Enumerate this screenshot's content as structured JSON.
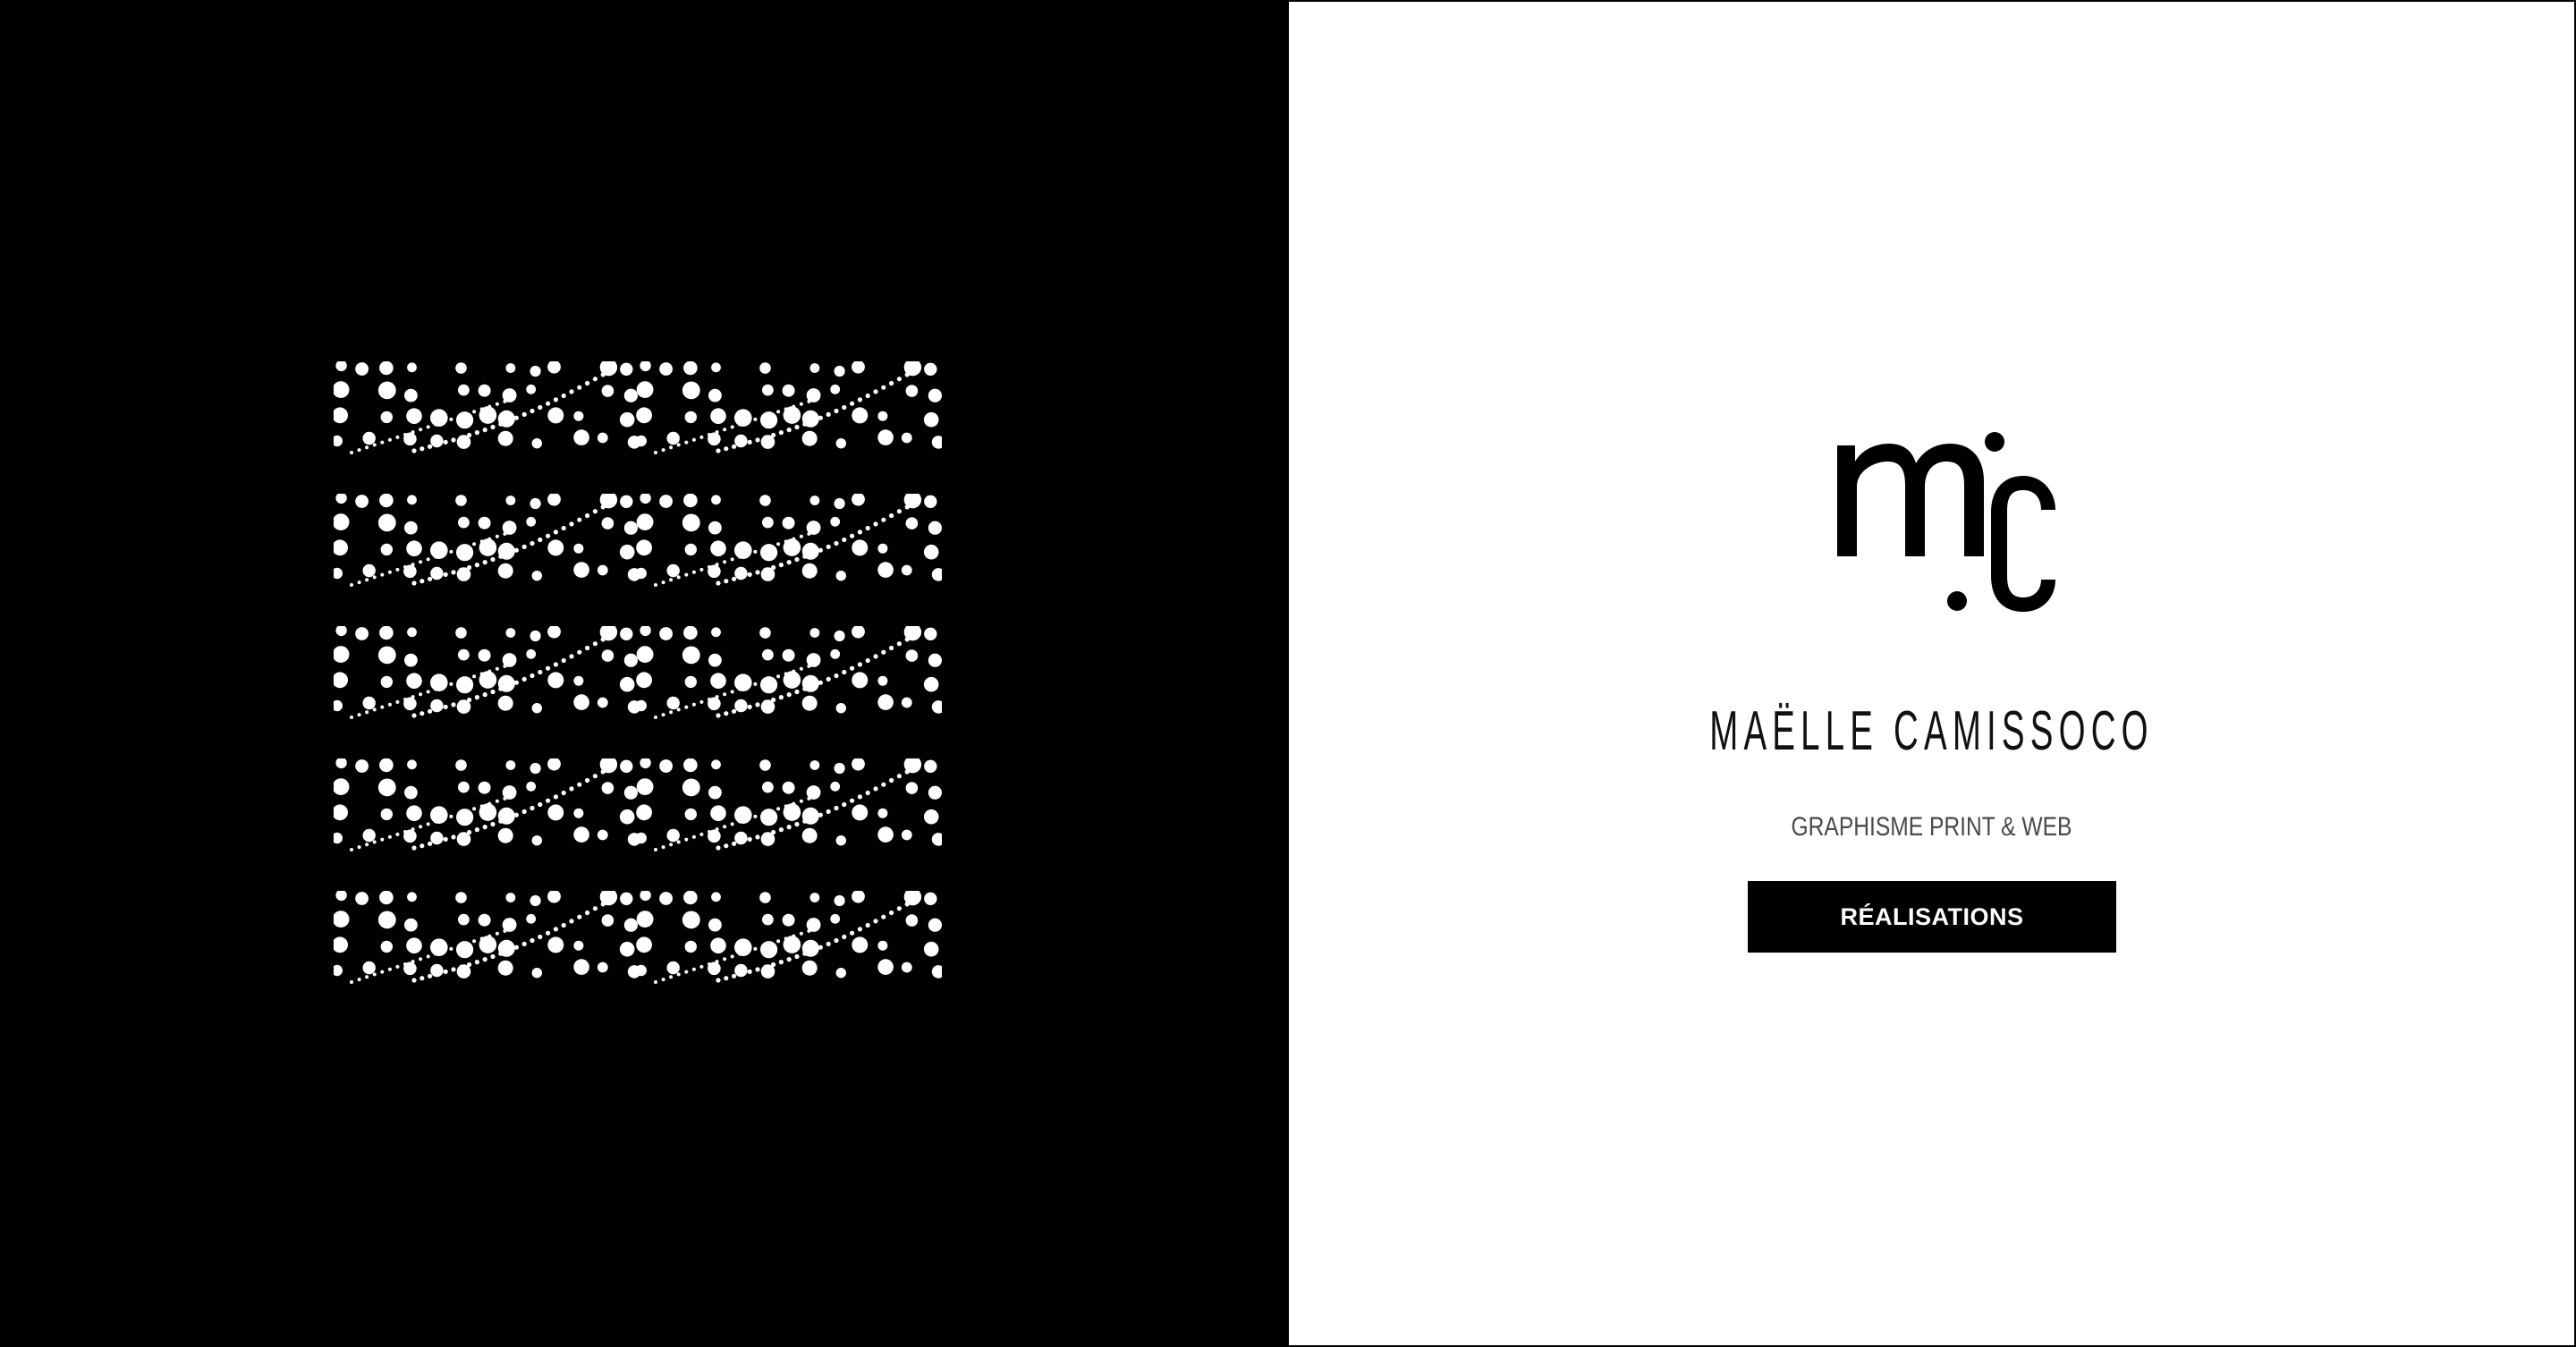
{
  "hero": {
    "logo_name": "mc-monogram-logo",
    "pattern_name": "dotted-pattern-bands",
    "pattern_band_count": 5
  },
  "brand": {
    "name": "MAËLLE CAMISSOCO",
    "tagline": "GRAPHISME PRINT & WEB"
  },
  "cta": {
    "label": "RÉALISATIONS"
  },
  "colors": {
    "dark": "#000000",
    "light": "#ffffff",
    "text": "#111111",
    "muted": "#4a4a4a"
  }
}
